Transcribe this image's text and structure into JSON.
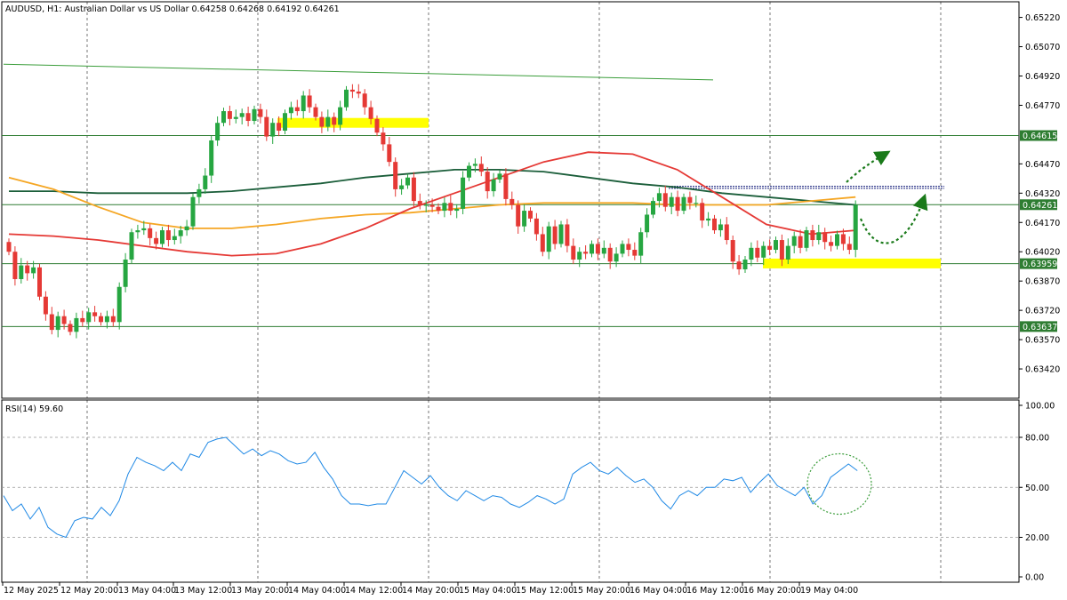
{
  "header": {
    "symbol": "AUDUSD, H1:",
    "description": "Australian Dollar vs US Dollar",
    "ohlc": "0.64258 0.64268 0.64192 0.64261"
  },
  "rsi_label": "RSI(14) 59.60",
  "colors": {
    "bull": "#26a641",
    "bear": "#e53935",
    "ma_red": "#e53935",
    "ma_orange": "#f5a623",
    "ma_dark": "#1b5e3a",
    "level_line": "#2e7d32",
    "highlight": "#ffff00",
    "rsi_line": "#1e88e5",
    "arrow": "#1a7a1a",
    "channel_line": "#3a9d3a",
    "resistance_dotted": "#1a237e"
  },
  "chart_data": [
    {
      "type": "candlestick",
      "title": "AUDUSD, H1: Australian Dollar vs US Dollar",
      "ylim": [
        0.6327,
        0.653
      ],
      "y_ticks": [
        "0.65220",
        "0.65070",
        "0.64920",
        "0.64770",
        "0.64470",
        "0.64320",
        "0.64170",
        "0.64020",
        "0.63870",
        "0.63720",
        "0.63570",
        "0.63420"
      ],
      "x_ticks": [
        "12 May 2025",
        "12 May 20:00",
        "13 May 04:00",
        "13 May 12:00",
        "13 May 20:00",
        "14 May 04:00",
        "14 May 12:00",
        "14 May 20:00",
        "15 May 04:00",
        "15 May 12:00",
        "15 May 20:00",
        "16 May 04:00",
        "16 May 12:00",
        "16 May 20:00",
        "19 May 04:00"
      ],
      "level_labels": [
        {
          "value": 0.64615,
          "label": "0.64615"
        },
        {
          "value": 0.64261,
          "label": "0.64261"
        },
        {
          "value": 0.63959,
          "label": "0.63959"
        },
        {
          "value": 0.63637,
          "label": "0.63637"
        }
      ],
      "close": [
        0.6402,
        0.6388,
        0.6395,
        0.6391,
        0.6394,
        0.6379,
        0.637,
        0.6362,
        0.6369,
        0.6365,
        0.6361,
        0.6368,
        0.6366,
        0.6371,
        0.6369,
        0.6366,
        0.6369,
        0.6366,
        0.6384,
        0.6398,
        0.6412,
        0.6413,
        0.6414,
        0.6409,
        0.6406,
        0.6413,
        0.6408,
        0.641,
        0.6413,
        0.6415,
        0.643,
        0.6434,
        0.6441,
        0.6459,
        0.6468,
        0.6474,
        0.647,
        0.6471,
        0.6473,
        0.6469,
        0.6475,
        0.6471,
        0.6461,
        0.6468,
        0.6464,
        0.6473,
        0.6476,
        0.6474,
        0.6482,
        0.6476,
        0.6471,
        0.6466,
        0.6471,
        0.6467,
        0.6476,
        0.6485,
        0.6484,
        0.6483,
        0.6476,
        0.647,
        0.6463,
        0.6457,
        0.6448,
        0.6434,
        0.6436,
        0.644,
        0.6428,
        0.6426,
        0.6426,
        0.6425,
        0.6423,
        0.6427,
        0.6423,
        0.6424,
        0.644,
        0.6446,
        0.6447,
        0.6443,
        0.6433,
        0.6439,
        0.6442,
        0.6429,
        0.6426,
        0.6415,
        0.6423,
        0.6419,
        0.6411,
        0.6402,
        0.6415,
        0.6406,
        0.6416,
        0.6405,
        0.6398,
        0.6402,
        0.6401,
        0.6406,
        0.6401,
        0.6404,
        0.6397,
        0.6401,
        0.6406,
        0.6403,
        0.64,
        0.6412,
        0.6421,
        0.6428,
        0.6432,
        0.6425,
        0.643,
        0.6423,
        0.643,
        0.6427,
        0.6427,
        0.6418,
        0.6419,
        0.6413,
        0.6416,
        0.6408,
        0.6397,
        0.6393,
        0.6398,
        0.6404,
        0.6399,
        0.6405,
        0.6403,
        0.6408,
        0.6398,
        0.6405,
        0.641,
        0.6404,
        0.6413,
        0.6408,
        0.6412,
        0.6407,
        0.6405,
        0.6411,
        0.6406,
        0.6403,
        0.6426
      ],
      "ma_red": [
        0.6411,
        0.641,
        0.6408,
        0.6405,
        0.6402,
        0.64,
        0.6401,
        0.6406,
        0.6414,
        0.6424,
        0.6432,
        0.644,
        0.6448,
        0.6453,
        0.6452,
        0.6444,
        0.643,
        0.6416,
        0.6411,
        0.6413
      ],
      "ma_orange": [
        0.644,
        0.6434,
        0.6425,
        0.6417,
        0.6414,
        0.6414,
        0.6416,
        0.6419,
        0.6421,
        0.6422,
        0.6424,
        0.6426,
        0.6427,
        0.6427,
        0.6427,
        0.6426,
        0.6426,
        0.6426,
        0.6428,
        0.643
      ],
      "ma_dark": [
        0.6433,
        0.6433,
        0.6432,
        0.6432,
        0.6432,
        0.6433,
        0.6435,
        0.6437,
        0.644,
        0.6442,
        0.6444,
        0.6444,
        0.6443,
        0.644,
        0.6437,
        0.6435,
        0.6432,
        0.643,
        0.6428,
        0.6426
      ]
    },
    {
      "type": "line",
      "title": "RSI(14) 59.60",
      "ylim": [
        0,
        100
      ],
      "y_ticks": [
        "100.00",
        "80.00",
        "50.00",
        "20.00",
        "0.00"
      ],
      "values": [
        45,
        36,
        40,
        31,
        38,
        26,
        22,
        20,
        30,
        32,
        31,
        38,
        33,
        42,
        58,
        68,
        65,
        63,
        60,
        65,
        60,
        70,
        68,
        77,
        79,
        80,
        75,
        70,
        73,
        69,
        72,
        70,
        66,
        64,
        65,
        71,
        62,
        55,
        45,
        40,
        40,
        39,
        40,
        40,
        50,
        60,
        56,
        52,
        57,
        50,
        45,
        42,
        48,
        45,
        42,
        45,
        44,
        40,
        38,
        41,
        45,
        43,
        40,
        43,
        58,
        62,
        65,
        60,
        58,
        62,
        57,
        53,
        55,
        50,
        42,
        37,
        45,
        48,
        45,
        50,
        50,
        55,
        54,
        56,
        47,
        53,
        58,
        51,
        48,
        45,
        50,
        40,
        45,
        56,
        60,
        64,
        60
      ]
    }
  ]
}
